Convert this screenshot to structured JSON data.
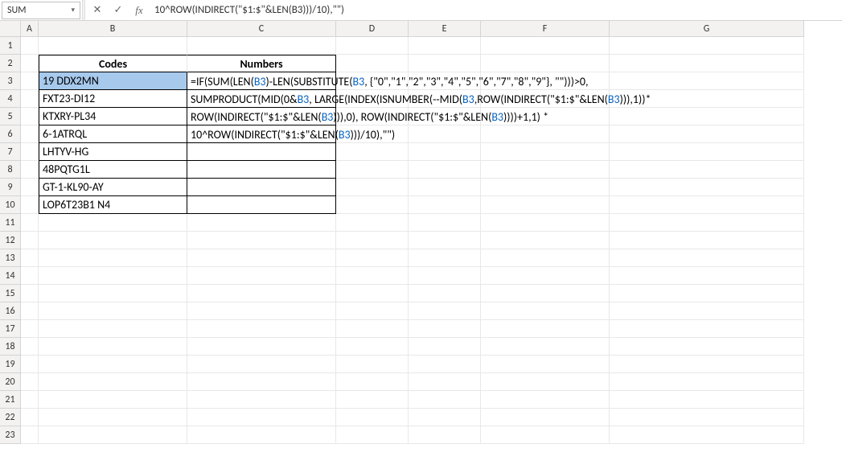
{
  "name_box": {
    "value": "SUM"
  },
  "formula_bar": {
    "value": "10^ROW(INDIRECT(\"$1:$\"&LEN(B3)))/10),\"\")"
  },
  "columns": [
    "A",
    "B",
    "C",
    "D",
    "E",
    "F",
    "G"
  ],
  "rows": [
    "1",
    "2",
    "3",
    "4",
    "5",
    "6",
    "7",
    "8",
    "9",
    "10",
    "11",
    "12",
    "13",
    "14",
    "15",
    "16",
    "17",
    "18",
    "19",
    "20",
    "21",
    "22",
    "23"
  ],
  "table": {
    "headers": {
      "codes": "Codes",
      "numbers": "Numbers"
    },
    "data": [
      {
        "code": "19 DDX2MN"
      },
      {
        "code": "FXT23-DI12"
      },
      {
        "code": "KTXRY-PL34"
      },
      {
        "code": "6-1ATRQL"
      },
      {
        "code": "LHTYV-HG"
      },
      {
        "code": "48PQTG1L"
      },
      {
        "code": "GT-1-KL90-AY"
      },
      {
        "code": "LOP6T23B1 N4"
      }
    ]
  },
  "formula_lines": {
    "line1": {
      "p1": "=IF(SUM(LEN(",
      "ref1": "B3",
      "p2": ")-LEN(SUBSTITUTE(",
      "ref2": "B3",
      "p3": ", {\"0\",\"1\",\"2\",\"3\",\"4\",\"5\",\"6\",\"7\",\"8\",\"9\"}, \"\")))>0,"
    },
    "line2": {
      "p1": "SUMPRODUCT(MID(0&",
      "ref1": "B3",
      "p2": ", LARGE(INDEX(ISNUMBER(--MID(",
      "ref2": "B3",
      "p3": ",ROW(INDIRECT(\"$1:$\"&LEN(",
      "ref3": "B3",
      "p4": "))),1))*"
    },
    "line3": {
      "p1": "ROW(INDIRECT(\"$1:$\"&LEN(",
      "ref1": "B3",
      "p2": "))),0), ROW(INDIRECT(\"$1:$\"&LEN(",
      "ref2": "B3",
      "p3": "))))+1,1) *"
    },
    "line4": {
      "p1": "10^ROW(INDIRECT(\"$1:$\"&LEN(",
      "ref1": "B3",
      "p2": ")))/10),\"\")"
    }
  },
  "icons": {
    "cancel": "✕",
    "confirm": "✓",
    "fx": "fx",
    "dropdown": "▾"
  }
}
